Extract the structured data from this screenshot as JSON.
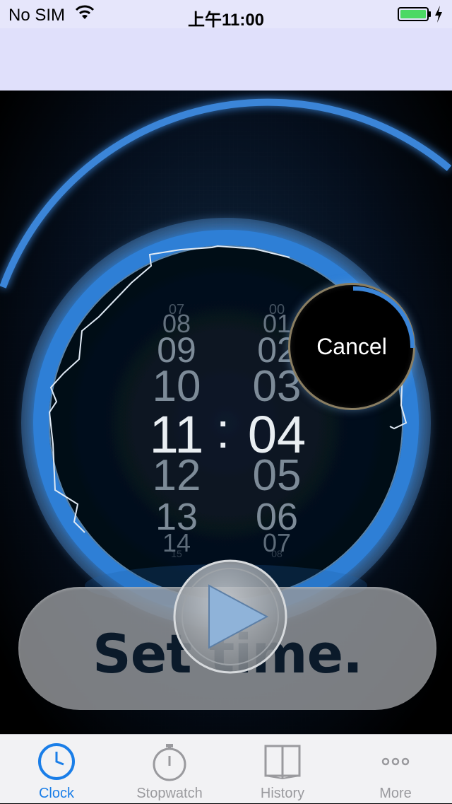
{
  "status_bar": {
    "carrier": "No SIM",
    "time": "上午11:00"
  },
  "picker": {
    "hours": [
      "07",
      "08",
      "09",
      "10",
      "11",
      "12",
      "13",
      "14",
      "15"
    ],
    "minutes": [
      "00",
      "01",
      "02",
      "03",
      "04",
      "05",
      "06",
      "07",
      "08"
    ],
    "selected_hour": "11",
    "selected_minute": "04",
    "separator": ":"
  },
  "cancel_button": {
    "label": "Cancel"
  },
  "set_time_label": "Set time.",
  "tabs": [
    {
      "label": "Clock",
      "icon": "clock-icon",
      "active": true
    },
    {
      "label": "Stopwatch",
      "icon": "stopwatch-icon",
      "active": false
    },
    {
      "label": "History",
      "icon": "book-icon",
      "active": false
    },
    {
      "label": "More",
      "icon": "more-icon",
      "active": false
    }
  ],
  "colors": {
    "accent": "#1a7ee8",
    "ring": "#2f7fd6",
    "inactive_tab": "#9a9a9e"
  }
}
